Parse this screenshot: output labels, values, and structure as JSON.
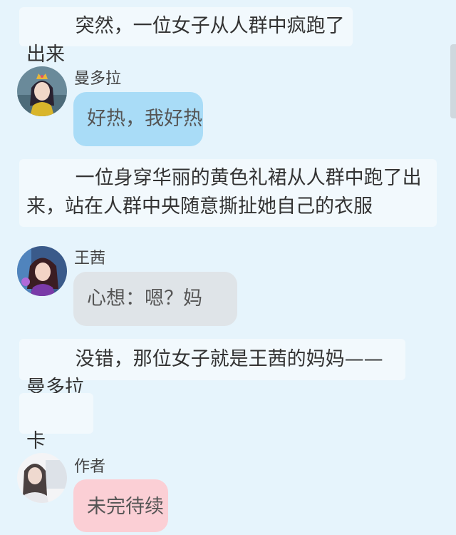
{
  "story": {
    "narration_1": "        突然，一位女子从人群中疯跑了出来",
    "narration_2": "        一位身穿华丽的黄色礼裙从人群中跑了出来，站在人群中央随意撕扯她自己的衣服",
    "narration_3": "        没错，那位女子就是王茜的妈妈——曼多拉",
    "narration_4": "        卡"
  },
  "messages": [
    {
      "speaker": "曼多拉",
      "text": "好热，我好热",
      "avatar_icon": "mandora-avatar-icon",
      "bubble_color": "#a9dcf7"
    },
    {
      "speaker": "王茜",
      "text": "心想：嗯？妈妈？",
      "avatar_icon": "wangqian-avatar-icon",
      "bubble_color": "#dfe4e8"
    },
    {
      "speaker": "作者",
      "text": "未完待续",
      "avatar_icon": "author-avatar-icon",
      "bubble_color": "#fbcfd5"
    }
  ],
  "colors": {
    "background": "#e6f4fc",
    "narration_bg": "#f2f9fd"
  }
}
